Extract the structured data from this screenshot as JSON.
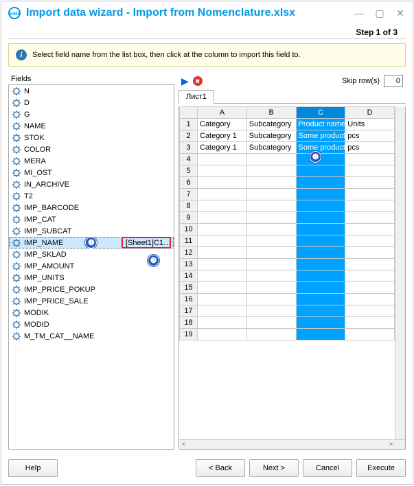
{
  "title": "Import data wizard - Import from Nomenclature.xlsx",
  "step_label": "Step 1 of 3",
  "info_text": "Select field name from the list box, then click at the column to import this field to.",
  "fields_label": "Fields",
  "fields": [
    {
      "name": "N"
    },
    {
      "name": "D"
    },
    {
      "name": "G"
    },
    {
      "name": "NAME"
    },
    {
      "name": "STOK"
    },
    {
      "name": "COLOR"
    },
    {
      "name": "MERA"
    },
    {
      "name": "MI_OST"
    },
    {
      "name": "IN_ARCHIVE"
    },
    {
      "name": "T2"
    },
    {
      "name": "IMP_BARCODE"
    },
    {
      "name": "IMP_CAT"
    },
    {
      "name": "IMP_SUBCAT"
    },
    {
      "name": "IMP_NAME",
      "selected": true,
      "value": "[Sheet1]C1…"
    },
    {
      "name": "IMP_SKLAD"
    },
    {
      "name": "IMP_AMOUNT"
    },
    {
      "name": "IMP_UNITS"
    },
    {
      "name": "IMP_PRICE_POKUP"
    },
    {
      "name": "IMP_PRICE_SALE"
    },
    {
      "name": "MODIK"
    },
    {
      "name": "MODID"
    },
    {
      "name": "M_TM_CAT__NAME"
    }
  ],
  "skip_label": "Skip row(s)",
  "skip_value": "0",
  "sheet_tab": "Лист1",
  "columns": [
    "A",
    "B",
    "C",
    "D"
  ],
  "selected_col": 2,
  "rows": [
    [
      "Category",
      "Subcategory",
      "Product name",
      "Units"
    ],
    [
      "Category 1",
      "Subcategory",
      "Some product",
      "pcs"
    ],
    [
      "Category 1",
      "Subcategory",
      "Some product",
      "pcs"
    ]
  ],
  "total_rows": 19,
  "buttons": {
    "help": "Help",
    "back": "< Back",
    "next": "Next >",
    "cancel": "Cancel",
    "execute": "Execute"
  },
  "callouts": {
    "one": "❶",
    "two": "❷",
    "three": "❸"
  }
}
